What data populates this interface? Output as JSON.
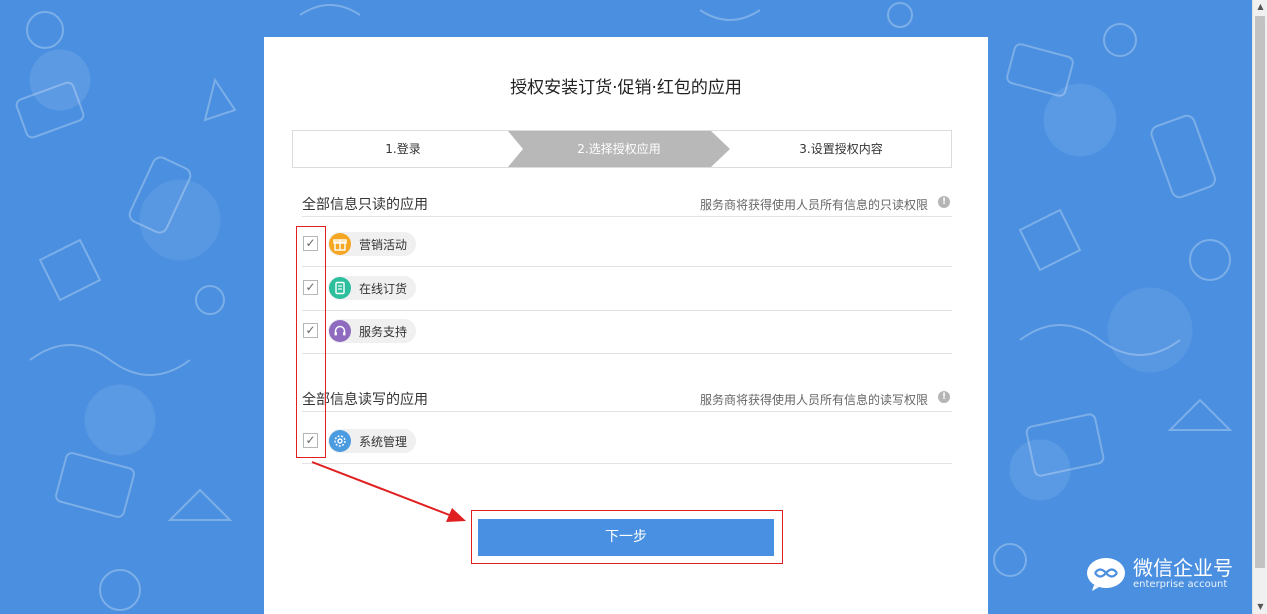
{
  "title": "授权安装订货·促销·红包的应用",
  "steps": [
    {
      "label": "1.登录"
    },
    {
      "label": "2.选择授权应用"
    },
    {
      "label": "3.设置授权内容"
    }
  ],
  "sections": [
    {
      "title": "全部信息只读的应用",
      "note": "服务商将获得使用人员所有信息的只读权限",
      "apps": [
        {
          "label": "营销活动",
          "icon": "gift-icon",
          "color": "#f5a623",
          "checked": true
        },
        {
          "label": "在线订货",
          "icon": "document-icon",
          "color": "#2bbf9e",
          "checked": true
        },
        {
          "label": "服务支持",
          "icon": "headset-icon",
          "color": "#8e6bbf",
          "checked": true
        }
      ]
    },
    {
      "title": "全部信息读写的应用",
      "note": "服务商将获得使用人员所有信息的读写权限",
      "apps": [
        {
          "label": "系统管理",
          "icon": "gear-icon",
          "color": "#4a9be0",
          "checked": true
        }
      ]
    }
  ],
  "next_button": "下一步",
  "logo": {
    "name": "微信企业号",
    "sub": "enterprise account",
    "icon": "wechat-enterprise-icon"
  },
  "colors": {
    "background": "#4a8fe0",
    "primary": "#4a90e2",
    "annotation": "#e02020"
  }
}
